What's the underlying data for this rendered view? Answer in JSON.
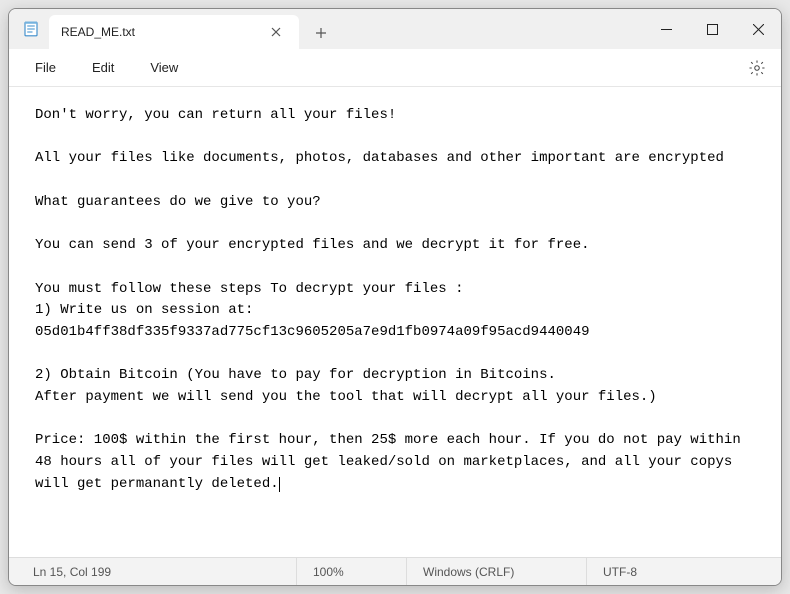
{
  "tab": {
    "title": "READ_ME.txt"
  },
  "menu": {
    "file": "File",
    "edit": "Edit",
    "view": "View"
  },
  "content": "Don't worry, you can return all your files!\n\nAll your files like documents, photos, databases and other important are encrypted\n\nWhat guarantees do we give to you?\n\nYou can send 3 of your encrypted files and we decrypt it for free.\n\nYou must follow these steps To decrypt your files :\n1) Write us on session at: 05d01b4ff38df335f9337ad775cf13c9605205a7e9d1fb0974a09f95acd9440049\n\n2) Obtain Bitcoin (You have to pay for decryption in Bitcoins.\nAfter payment we will send you the tool that will decrypt all your files.)\n\nPrice: 100$ within the first hour, then 25$ more each hour. If you do not pay within 48 hours all of your files will get leaked/sold on marketplaces, and all your copys will get permanantly deleted.",
  "status": {
    "position": "Ln 15, Col 199",
    "zoom": "100%",
    "line_ending": "Windows (CRLF)",
    "encoding": "UTF-8"
  }
}
